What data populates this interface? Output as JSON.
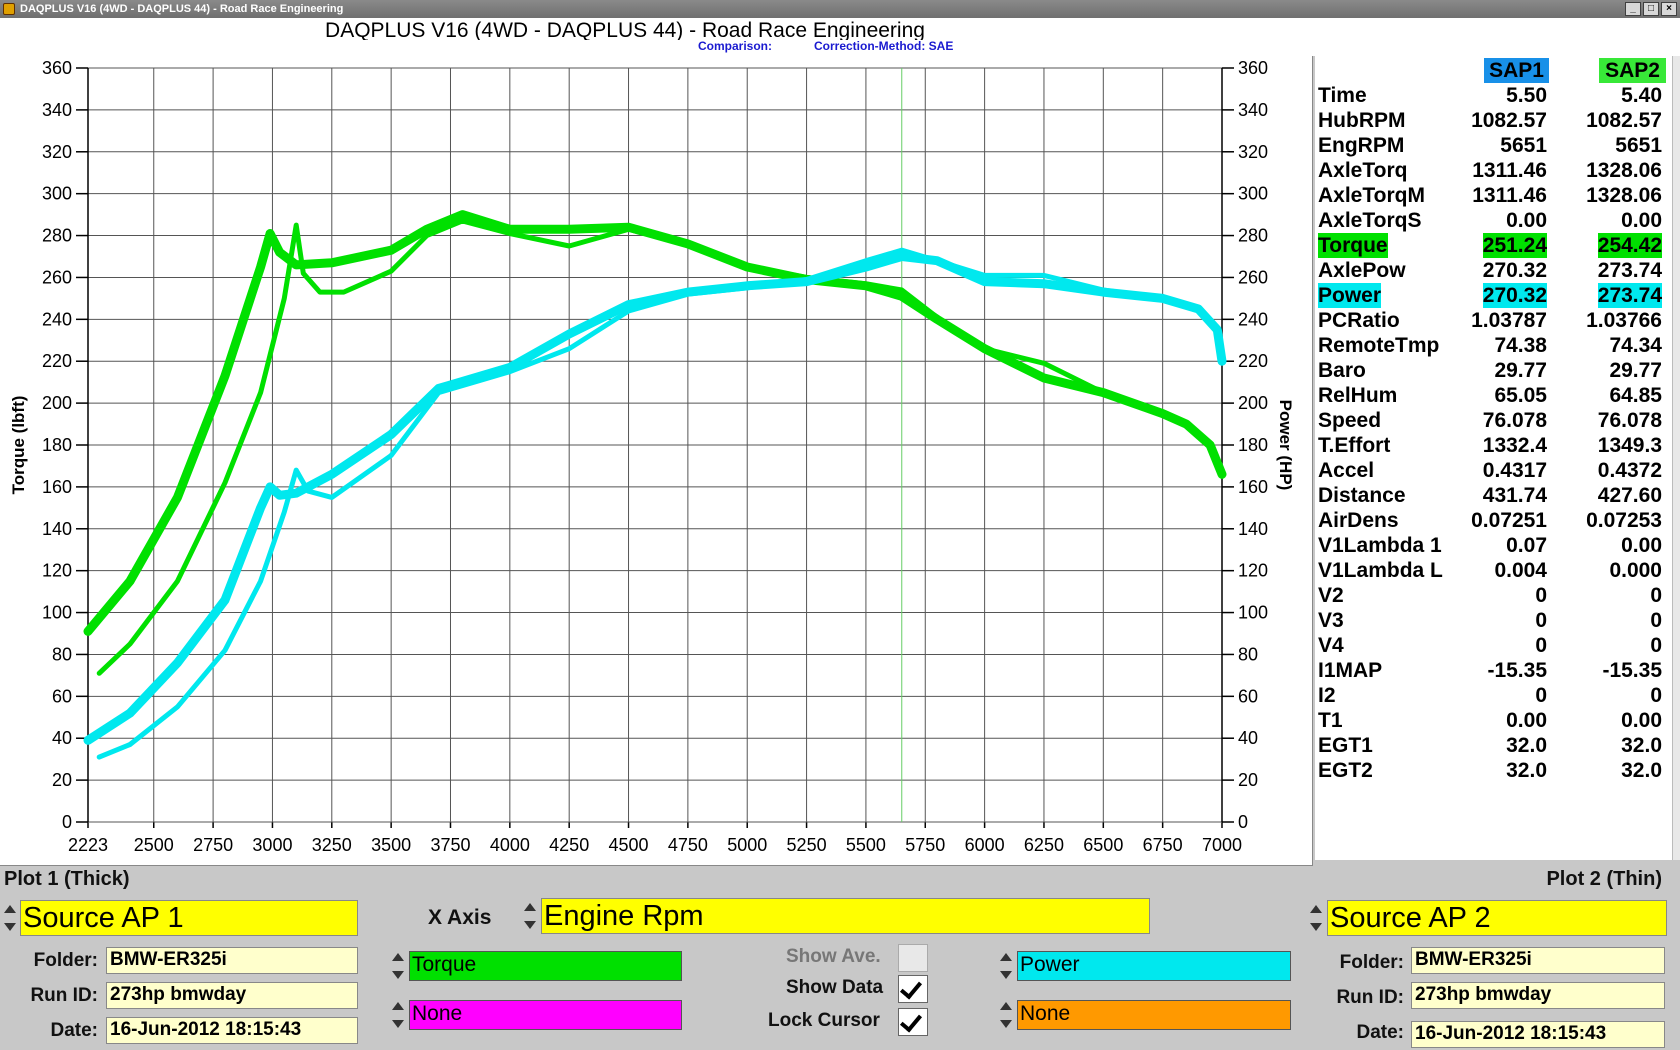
{
  "window": {
    "title": "DAQPLUS V16 (4WD - DAQPLUS 44) - Road Race Engineering"
  },
  "header": {
    "title": "DAQPLUS V16 (4WD - DAQPLUS 44) - Road Race Engineering",
    "comparison_label": "Comparison:",
    "correction_label": "Correction-Method: SAE"
  },
  "colors": {
    "torque": "#00e000",
    "power": "#00e8ee",
    "sap1": "#1890e8",
    "sap2": "#38e838",
    "field": "#ffff00",
    "magenta": "#ff00ff",
    "orange": "#ff9900"
  },
  "chart_data": {
    "type": "line",
    "xlabel": "",
    "ylabel_left": "Torque (lbft)",
    "ylabel_right": "Power (HP)",
    "xlim": [
      2223,
      7000
    ],
    "ylim": [
      0,
      360
    ],
    "x_ticks": [
      "2223",
      "2500",
      "2750",
      "3000",
      "3250",
      "3500",
      "3750",
      "4000",
      "4250",
      "4500",
      "4750",
      "5000",
      "5250",
      "5500",
      "5750",
      "6000",
      "6250",
      "6500",
      "6750",
      "7000"
    ],
    "y_ticks": [
      "0",
      "20",
      "40",
      "60",
      "80",
      "100",
      "120",
      "140",
      "160",
      "180",
      "200",
      "220",
      "240",
      "260",
      "280",
      "300",
      "320",
      "340",
      "360"
    ],
    "grid": true,
    "cursor_rpm": 5651,
    "series": [
      {
        "name": "Torque",
        "color": "#00e000",
        "x": [
          2223,
          2400,
          2600,
          2800,
          2950,
          2990,
          3030,
          3100,
          3250,
          3500,
          3650,
          3800,
          4000,
          4250,
          4500,
          4750,
          5000,
          5250,
          5500,
          5651,
          5800,
          6000,
          6250,
          6500,
          6750,
          6850,
          6950,
          7000
        ],
        "y": [
          91,
          115,
          155,
          213,
          265,
          281,
          272,
          266,
          267,
          273,
          283,
          290,
          283,
          283,
          284,
          276,
          265,
          259,
          256,
          251,
          240,
          226,
          212,
          205,
          195,
          190,
          180,
          166
        ]
      },
      {
        "name": "Torque",
        "color": "#00e000",
        "x": [
          2270,
          2400,
          2600,
          2800,
          2950,
          3050,
          3100,
          3130,
          3200,
          3300,
          3500,
          3650,
          3800,
          4000,
          4250,
          4500,
          4750,
          5000,
          5250,
          5500,
          5651,
          5800,
          6000,
          6250,
          6500,
          6750,
          6850,
          6950,
          7000
        ],
        "y": [
          71,
          85,
          115,
          162,
          205,
          250,
          285,
          262,
          253,
          253,
          263,
          280,
          287,
          281,
          275,
          283,
          276,
          265,
          260,
          257,
          254,
          241,
          226,
          219,
          205,
          195,
          190,
          180,
          166
        ]
      },
      {
        "name": "Power",
        "color": "#00e8ee",
        "x": [
          2223,
          2400,
          2600,
          2800,
          2950,
          2990,
          3030,
          3100,
          3250,
          3500,
          3700,
          4000,
          4250,
          4500,
          4750,
          5000,
          5250,
          5500,
          5651,
          5800,
          6000,
          6250,
          6500,
          6750,
          6900,
          6980,
          7000
        ],
        "y": [
          39,
          52,
          76,
          106,
          150,
          160,
          156,
          157,
          166,
          185,
          207,
          217,
          233,
          247,
          253,
          256,
          258,
          265,
          270,
          268,
          258,
          257,
          253,
          250,
          245,
          235,
          220
        ]
      },
      {
        "name": "Power",
        "color": "#00e8ee",
        "x": [
          2270,
          2400,
          2600,
          2800,
          2950,
          3050,
          3100,
          3150,
          3250,
          3500,
          3700,
          4000,
          4250,
          4500,
          4750,
          5000,
          5250,
          5500,
          5651,
          5800,
          6000,
          6250,
          6500,
          6750,
          6900,
          6980,
          7000
        ],
        "y": [
          31,
          37,
          55,
          82,
          115,
          148,
          168,
          158,
          155,
          175,
          205,
          215,
          226,
          244,
          252,
          255,
          259,
          268,
          273,
          268,
          261,
          261,
          254,
          250,
          245,
          235,
          220
        ]
      }
    ]
  },
  "data_table": {
    "headers": [
      "SAP1",
      "SAP2"
    ],
    "rows": [
      {
        "label": "Time",
        "v1": "5.50",
        "v2": "5.40"
      },
      {
        "label": "HubRPM",
        "v1": "1082.57",
        "v2": "1082.57"
      },
      {
        "label": "EngRPM",
        "v1": "5651",
        "v2": "5651"
      },
      {
        "label": "AxleTorq",
        "v1": "1311.46",
        "v2": "1328.06"
      },
      {
        "label": "AxleTorqM",
        "v1": "1311.46",
        "v2": "1328.06"
      },
      {
        "label": "AxleTorqS",
        "v1": "0.00",
        "v2": "0.00"
      },
      {
        "label": "Torque",
        "v1": "251.24",
        "v2": "254.42",
        "hl": "green"
      },
      {
        "label": "AxlePow",
        "v1": "270.32",
        "v2": "273.74"
      },
      {
        "label": "Power",
        "v1": "270.32",
        "v2": "273.74",
        "hl": "cyan"
      },
      {
        "label": "PCRatio",
        "v1": "1.03787",
        "v2": "1.03766"
      },
      {
        "label": "RemoteTmp",
        "v1": "74.38",
        "v2": "74.34"
      },
      {
        "label": "Baro",
        "v1": "29.77",
        "v2": "29.77"
      },
      {
        "label": "RelHum",
        "v1": "65.05",
        "v2": "64.85"
      },
      {
        "label": "Speed",
        "v1": "76.078",
        "v2": "76.078"
      },
      {
        "label": "T.Effort",
        "v1": "1332.4",
        "v2": "1349.3"
      },
      {
        "label": "Accel",
        "v1": "0.4317",
        "v2": "0.4372"
      },
      {
        "label": "Distance",
        "v1": "431.74",
        "v2": "427.60"
      },
      {
        "label": "AirDens",
        "v1": "0.07251",
        "v2": "0.07253"
      },
      {
        "label": "V1Lambda 1",
        "v1": "0.07",
        "v2": "0.00"
      },
      {
        "label": "V1Lambda L",
        "v1": "0.004",
        "v2": "0.000"
      },
      {
        "label": "V2",
        "v1": "0",
        "v2": "0"
      },
      {
        "label": "V3",
        "v1": "0",
        "v2": "0"
      },
      {
        "label": "V4",
        "v1": "0",
        "v2": "0"
      },
      {
        "label": "I1MAP",
        "v1": "-15.35",
        "v2": "-15.35"
      },
      {
        "label": "I2",
        "v1": "0",
        "v2": "0"
      },
      {
        "label": "T1",
        "v1": "0.00",
        "v2": "0.00"
      },
      {
        "label": "EGT1",
        "v1": "32.0",
        "v2": "32.0"
      },
      {
        "label": "EGT2",
        "v1": "32.0",
        "v2": "32.0"
      }
    ]
  },
  "bottom": {
    "plot1_label": "Plot 1 (Thick)",
    "plot2_label": "Plot 2 (Thin)",
    "source1": "Source AP 1",
    "source2": "Source AP 2",
    "xaxis_label": "X Axis",
    "xaxis_value": "Engine Rpm",
    "folder_label": "Folder:",
    "runid_label": "Run ID:",
    "date_label": "Date:",
    "left": {
      "folder": "BMW-ER325i",
      "runid": "273hp bmwday",
      "date": "16-Jun-2012  18:15:43"
    },
    "right": {
      "folder": "BMW-ER325i",
      "runid": "273hp bmwday",
      "date": "16-Jun-2012  18:15:43"
    },
    "chan1a": "Torque",
    "chan1b": "None",
    "chan2a": "Power",
    "chan2b": "None",
    "show_ave": "Show Ave.",
    "show_data": "Show Data",
    "lock_cursor": "Lock Cursor"
  }
}
